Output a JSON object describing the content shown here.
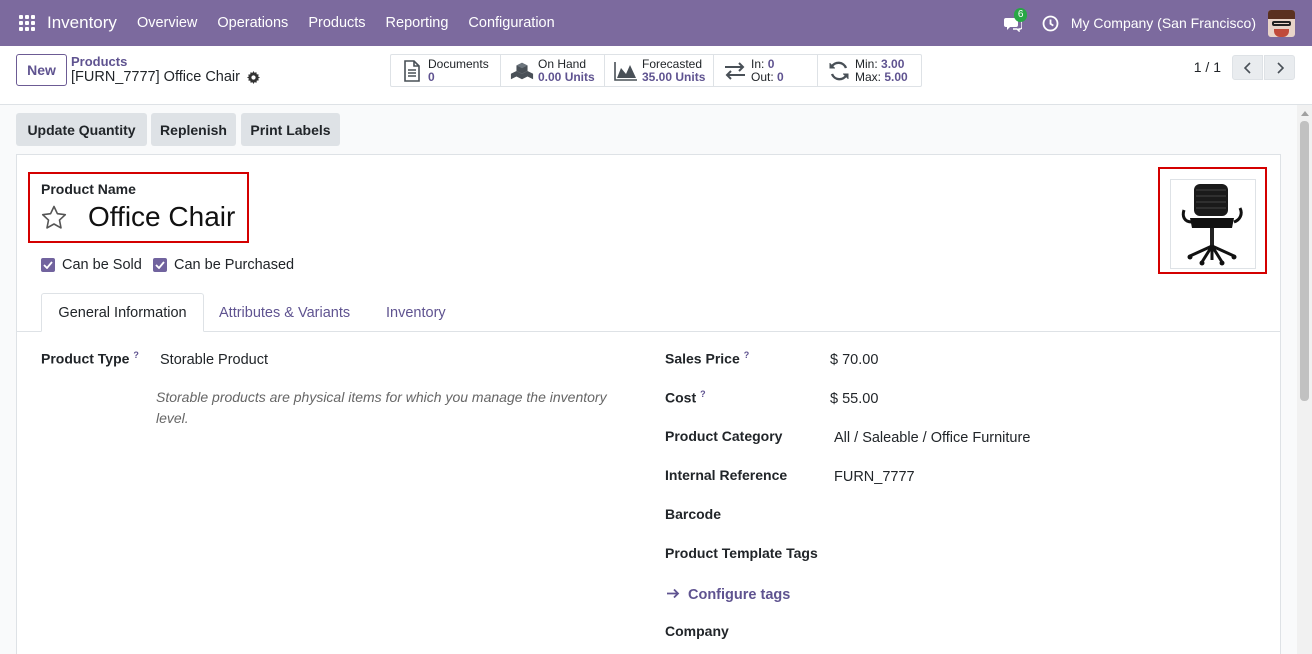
{
  "navbar": {
    "app_name": "Inventory",
    "menu": [
      "Overview",
      "Operations",
      "Products",
      "Reporting",
      "Configuration"
    ],
    "chat_count": "6",
    "company": "My Company (San Francisco)"
  },
  "control": {
    "new_label": "New",
    "breadcrumb_parent": "Products",
    "breadcrumb_current": "[FURN_7777] Office Chair",
    "pager": "1 / 1",
    "smart_buttons": {
      "documents": {
        "label": "Documents",
        "value": "0"
      },
      "on_hand": {
        "label": "On Hand",
        "value": "0.00 Units"
      },
      "forecasted": {
        "label": "Forecasted",
        "value": "35.00 Units"
      },
      "in_out": {
        "in_label": "In:",
        "in_value": "0",
        "out_label": "Out:",
        "out_value": "0"
      },
      "min_max": {
        "min_label": "Min:",
        "min_value": "3.00",
        "max_label": "Max:",
        "max_value": "5.00"
      }
    }
  },
  "actions": {
    "update_quantity": "Update Quantity",
    "replenish": "Replenish",
    "print_labels": "Print Labels"
  },
  "form": {
    "product_name_label": "Product Name",
    "product_name": "Office Chair",
    "can_be_sold": "Can be Sold",
    "can_be_purchased": "Can be Purchased",
    "tabs": [
      "General Information",
      "Attributes & Variants",
      "Inventory"
    ],
    "product_type_label": "Product Type",
    "product_type_value": "Storable Product",
    "product_type_help": "Storable products are physical items for which you manage the inventory level.",
    "sales_price_label": "Sales Price",
    "sales_price_value": "$ 70.00",
    "cost_label": "Cost",
    "cost_value": "$ 55.00",
    "category_label": "Product Category",
    "category_value": "All / Saleable / Office Furniture",
    "internal_ref_label": "Internal Reference",
    "internal_ref_value": "FURN_7777",
    "barcode_label": "Barcode",
    "tags_label": "Product Template Tags",
    "configure_tags": "Configure tags",
    "company_label": "Company",
    "help_marker": "?"
  },
  "colors": {
    "navbar": "#7c6a9e",
    "accent": "#5f5390",
    "highlight_border": "#d40000"
  }
}
